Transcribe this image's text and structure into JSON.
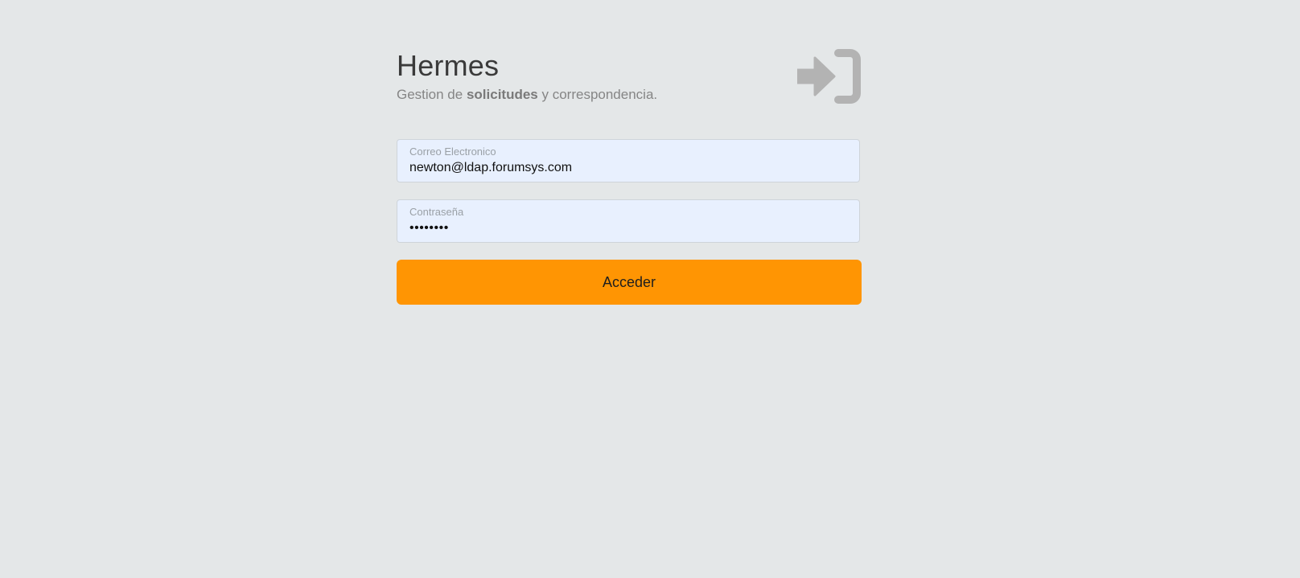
{
  "app": {
    "title": "Hermes",
    "subtitle_pre": "Gestion de ",
    "subtitle_bold": "solicitudes",
    "subtitle_post": " y correspondencia.",
    "icon": "sign-in-icon"
  },
  "form": {
    "email": {
      "label": "Correo Electronico",
      "value": "newton@ldap.forumsys.com"
    },
    "password": {
      "label": "Contraseña",
      "value": "password"
    },
    "submit_label": "Acceder"
  },
  "colors": {
    "background": "#e4e7e8",
    "input_bg": "#e8f0fe",
    "button": "#ff9503",
    "icon": "#b3b3b3"
  }
}
